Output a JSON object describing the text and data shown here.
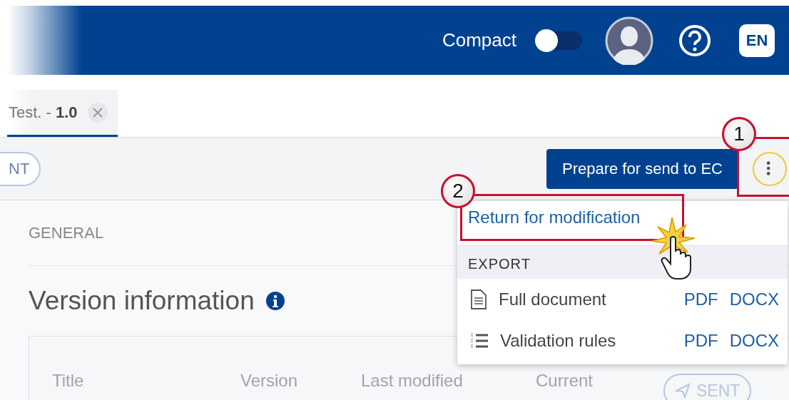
{
  "header": {
    "compact_label": "Compact",
    "compact_on": false,
    "language": "EN"
  },
  "tabs": [
    {
      "label": "Test. - **1.0**",
      "selected": true
    }
  ],
  "toolbar": {
    "status": "NT",
    "primary_button": "Prepare for send to EC"
  },
  "section": {
    "label": "GENERAL",
    "title": "Version information"
  },
  "table": {
    "columns": [
      "Title",
      "Version",
      "Last modified",
      "Current"
    ],
    "status": "SENT"
  },
  "menu": {
    "items": [
      {
        "label": "Return for modification"
      }
    ],
    "export_header": "EXPORT",
    "exports": [
      {
        "label": "Full document",
        "kind": "document",
        "formats": [
          "PDF",
          "DOCX"
        ]
      },
      {
        "label": "Validation rules",
        "kind": "list",
        "formats": [
          "PDF",
          "DOCX"
        ]
      }
    ]
  },
  "callouts": [
    "1",
    "2"
  ]
}
